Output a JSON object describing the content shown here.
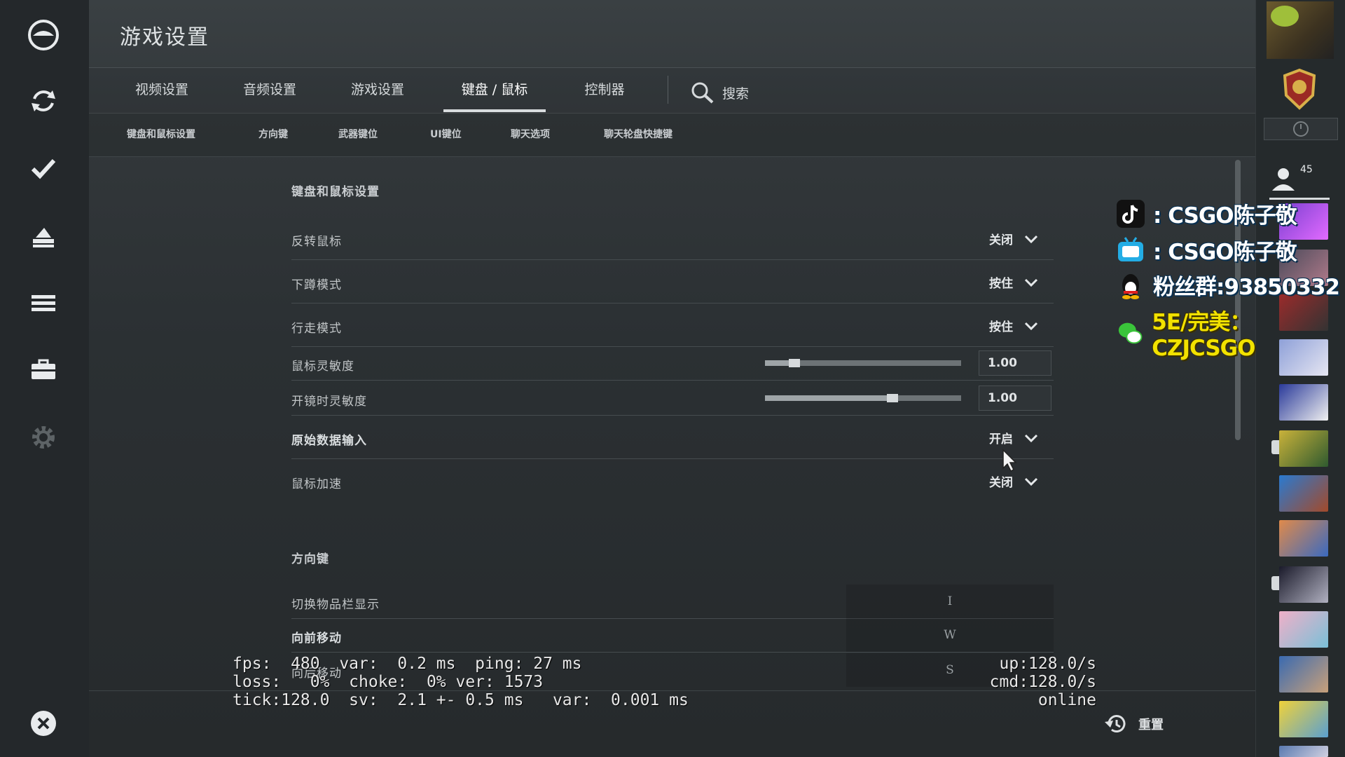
{
  "app": {
    "title": "游戏设置"
  },
  "tabs": [
    {
      "label": "视频设置"
    },
    {
      "label": "音频设置"
    },
    {
      "label": "游戏设置"
    },
    {
      "label": "键盘 / 鼠标",
      "active": true
    },
    {
      "label": "控制器"
    }
  ],
  "search": {
    "label": "搜索",
    "icon": "search-icon"
  },
  "subtabs": [
    "键盘和鼠标设置",
    "方向键",
    "武器键位",
    "UI键位",
    "聊天选项",
    "聊天轮盘快捷键"
  ],
  "sections": {
    "mouse": {
      "title": "键盘和鼠标设置",
      "invert_mouse": {
        "label": "反转鼠标",
        "value": "关闭"
      },
      "crouch_mode": {
        "label": "下蹲模式",
        "value": "按住"
      },
      "walk_mode": {
        "label": "行走模式",
        "value": "按住"
      },
      "sensitivity": {
        "label": "鼠标灵敏度",
        "value": "1.00",
        "slider_fraction": 0.15
      },
      "zoom_sensitivity": {
        "label": "开镜时灵敏度",
        "value": "1.00",
        "slider_fraction": 0.65
      },
      "raw_input": {
        "label": "原始数据输入",
        "value": "开启"
      },
      "mouse_accel": {
        "label": "鼠标加速",
        "value": "关闭"
      }
    },
    "movement": {
      "title": "方向键",
      "toggle_inventory": {
        "label": "切换物品栏显示",
        "key": "I"
      },
      "move_forward": {
        "label": "向前移动",
        "key": "W"
      },
      "move_back": {
        "label": "向后移动",
        "key": "S"
      }
    }
  },
  "netgraph": {
    "line1": "fps:  480  var:  0.2 ms  ping: 27 ms",
    "line2": "loss:   0%  choke:  0% ver: 1573",
    "line3": "tick:128.0  sv:  2.1 +- 0.5 ms   var:  0.001 ms",
    "right1": "up:128.0/s",
    "right2": "cmd:128.0/s",
    "right3": "online"
  },
  "footer": {
    "reset_label": "重置"
  },
  "friends": {
    "count": "45"
  },
  "overlay": {
    "douyin": ": CSGO陈子敬",
    "bilibili": ": CSGO陈子敬",
    "qq": "粉丝群:93850332",
    "wechat": "5E/完美：CZJCSGO"
  },
  "colors": {
    "accent": "#d8dcde",
    "panel": "#2b3033",
    "overlay_yellow": "#f2e200"
  }
}
